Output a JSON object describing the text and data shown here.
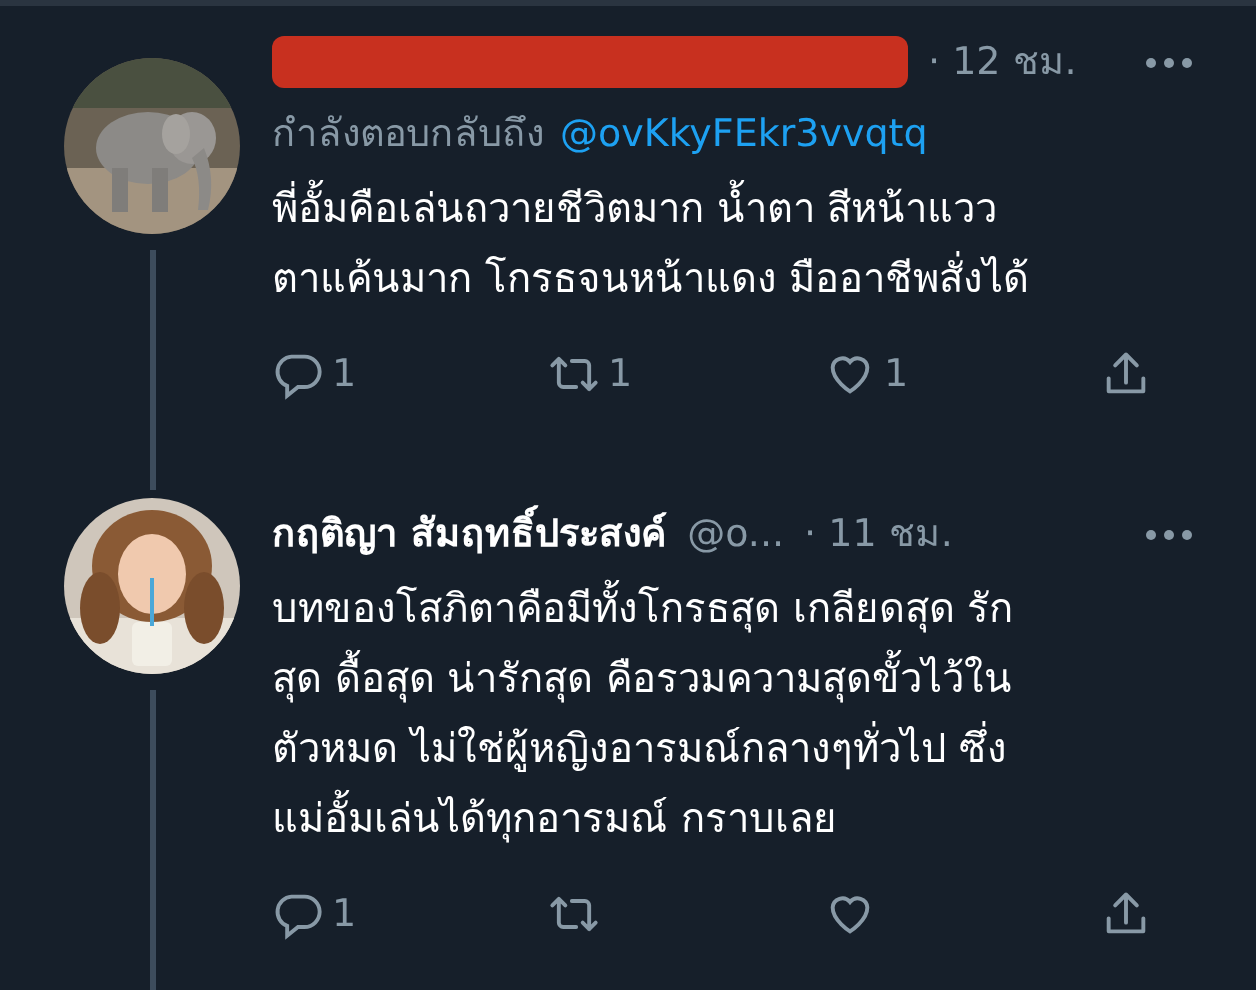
{
  "tweets": [
    {
      "redacted": true,
      "time": "· 12 ชม.",
      "reply_to": {
        "label": "กำลังตอบกลับถึง",
        "handle": "@ovKkyFEkr3vvqtq"
      },
      "text": "พี่อั้มคือเล่นถวายชีวิตมาก น้ำตา สีหน้าแวว\nตาแค้นมาก  โกรธจนหน้าแดง มืออาชีพสั่งได้",
      "actions": {
        "replies": "1",
        "retweets": "1",
        "likes": "1"
      }
    },
    {
      "name": "กฤติญา สัมฤทธิ์ประสงค์",
      "handle": "@o...",
      "redacted": false,
      "time": "· 11 ชม.",
      "text": "บทของโสภิตาคือมีทั้งโกรธสุด เกลียดสุด รัก\nสุด ดื้อสุด น่ารักสุด คือรวมความสุดขั้วไว้ใน\nตัวหมด ไม่ใช่ผู้หญิงอารมณ์กลางๆทั่วไป ซึ่ง\nแม่อั้มเล่นได้ทุกอารมณ์ กราบเลย",
      "actions": {
        "replies": "1"
      }
    }
  ]
}
